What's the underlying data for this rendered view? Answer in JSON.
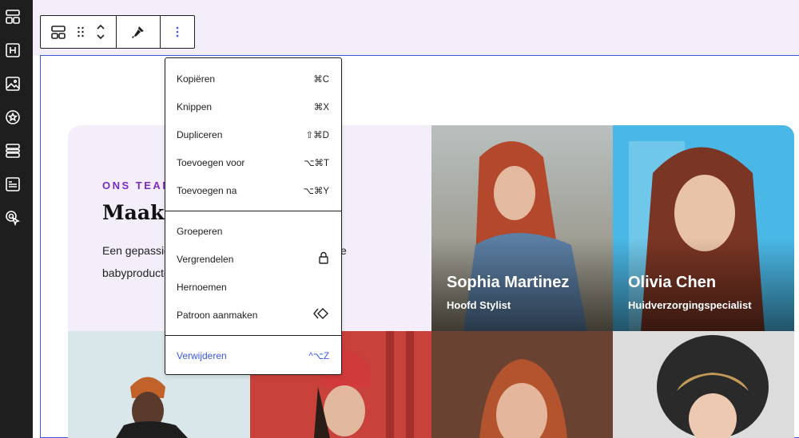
{
  "left_rail": {
    "icons": [
      "pattern-icon",
      "heading-icon",
      "image-icon",
      "star-icon",
      "group-icon",
      "document-icon",
      "cursor-pointer-icon"
    ]
  },
  "team_section": {
    "eyebrow": "ONS TEAM",
    "headline": "Maak k",
    "paragraph_line1": "Een gepassio",
    "paragraph_line1_tail": "e",
    "paragraph_line2": "babyproducte"
  },
  "people": [
    {
      "name": "Sophia Martinez",
      "role": "Hoofd Stylist"
    },
    {
      "name": "Olivia Chen",
      "role": "Huidverzorgingspecialist"
    }
  ],
  "context_menu": {
    "group1": [
      {
        "label": "Kopiëren",
        "shortcut": "⌘C"
      },
      {
        "label": "Knippen",
        "shortcut": "⌘X"
      },
      {
        "label": "Dupliceren",
        "shortcut": "⇧⌘D"
      },
      {
        "label": "Toevoegen voor",
        "shortcut": "⌥⌘T"
      },
      {
        "label": "Toevoegen na",
        "shortcut": "⌥⌘Y"
      }
    ],
    "group2": [
      {
        "label": "Groeperen"
      },
      {
        "label": "Vergrendelen",
        "icon": "lock-icon"
      },
      {
        "label": "Hernoemen"
      },
      {
        "label": "Patroon aanmaken",
        "icon": "pattern-diamond-icon"
      }
    ],
    "group3": [
      {
        "label": "Verwijderen",
        "shortcut": "^⌥Z"
      }
    ]
  },
  "colors": {
    "accent": "#3858e9",
    "eyebrow": "#7b2bc4",
    "band": "#f3eefa",
    "rail": "#1e1e1e"
  }
}
